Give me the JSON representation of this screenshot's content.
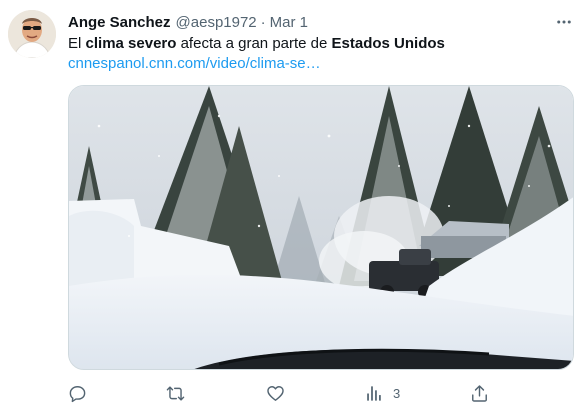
{
  "tweet": {
    "author_name": "Ange Sanchez",
    "handle": "@aesp1972",
    "separator": "·",
    "date": "Mar 1",
    "text_parts": {
      "p1": "El ",
      "p2": "clima severo",
      "p3": " afecta a gran parte de ",
      "p4": "Estados Unidos"
    },
    "link": "cnnespanol.cnn.com/video/clima-se…"
  },
  "media": {
    "type": "video-thumbnail"
  },
  "actions": {
    "reply": {
      "icon": "reply-icon"
    },
    "retweet": {
      "icon": "retweet-icon"
    },
    "like": {
      "icon": "heart-icon"
    },
    "views": {
      "icon": "views-chart-icon",
      "count": "3"
    },
    "share": {
      "icon": "share-icon"
    }
  },
  "colors": {
    "link": "#1d9bf0",
    "secondary_text": "#536471",
    "primary_text": "#0f1419"
  }
}
